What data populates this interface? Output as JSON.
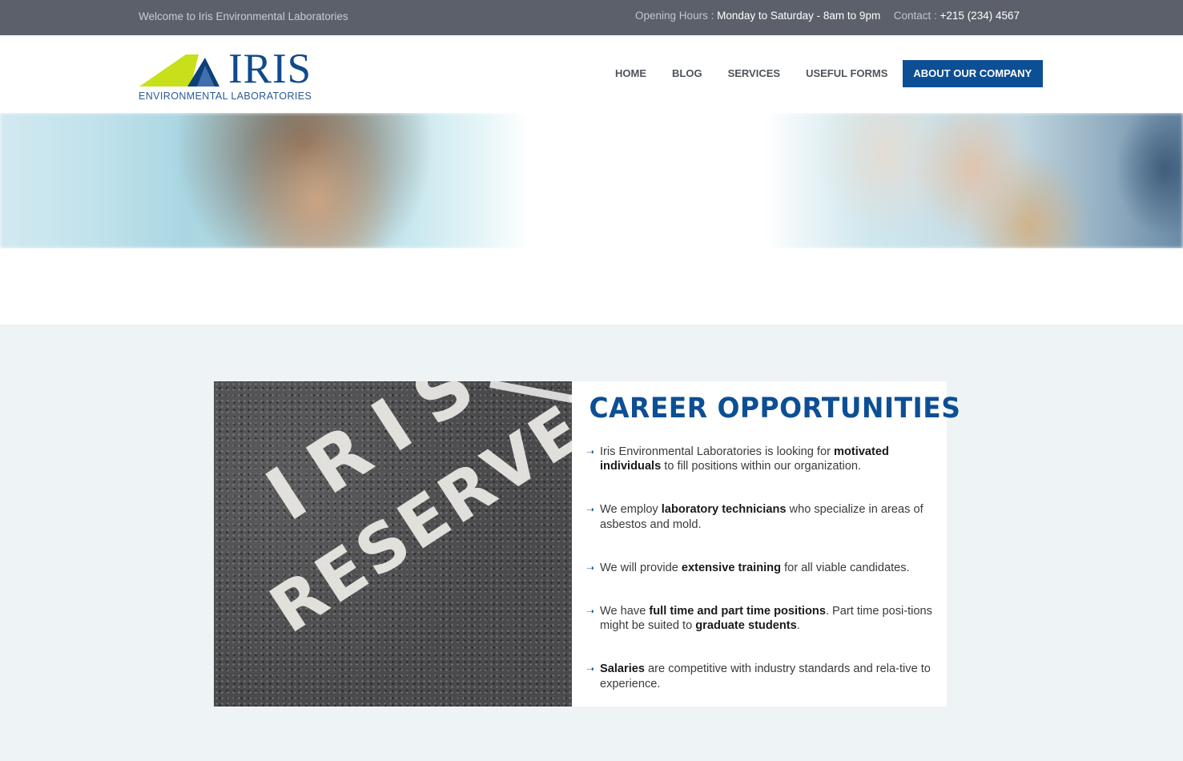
{
  "topbar": {
    "welcome": "Welcome to Iris Environmental Laboratories",
    "hours_label": "Opening Hours :",
    "hours_value": "Monday to Saturday - 8am to 9pm",
    "contact_label": "Contact :",
    "contact_value": "+215 (234) 4567"
  },
  "logo": {
    "word": "IRIS",
    "subtitle": "ENVIRONMENTAL  LABORATORIES"
  },
  "nav": [
    {
      "label": "HOME"
    },
    {
      "label": "BLOG"
    },
    {
      "label": "SERVICES"
    },
    {
      "label": "USEFUL FORMS"
    },
    {
      "label": "ABOUT OUR COMPANY",
      "active": true
    }
  ],
  "career": {
    "title": "CAREER OPPORTUNITIES",
    "photo_text_line1": "IRIS",
    "photo_text_line2": "RESERVED",
    "items": [
      {
        "pre": "Iris Environmental Laboratories is looking for ",
        "bold": "motivated individuals",
        "post": " to fill positions within our organization."
      },
      {
        "pre": "We employ ",
        "bold": "laboratory technicians",
        "post": " who specialize in areas of asbestos and mold."
      },
      {
        "pre": "We will provide ",
        "bold": "extensive training",
        "post": " for all viable candidates."
      },
      {
        "pre": "We have ",
        "bold": "full time and part time positions",
        "mid": ". Part time posi-tions might be suited to ",
        "bold2": "graduate students",
        "post": "."
      },
      {
        "pre": "",
        "bold": "Salaries",
        "post": " are competitive with industry standards and rela-tive to experience."
      }
    ]
  },
  "colors": {
    "topbar_bg": "#5b606a",
    "brand_blue": "#0d4f94",
    "logo_green": "#c8e01a",
    "section_bg": "#eef3f6"
  },
  "icons": {
    "list_bullet": "arrow-right-icon"
  }
}
